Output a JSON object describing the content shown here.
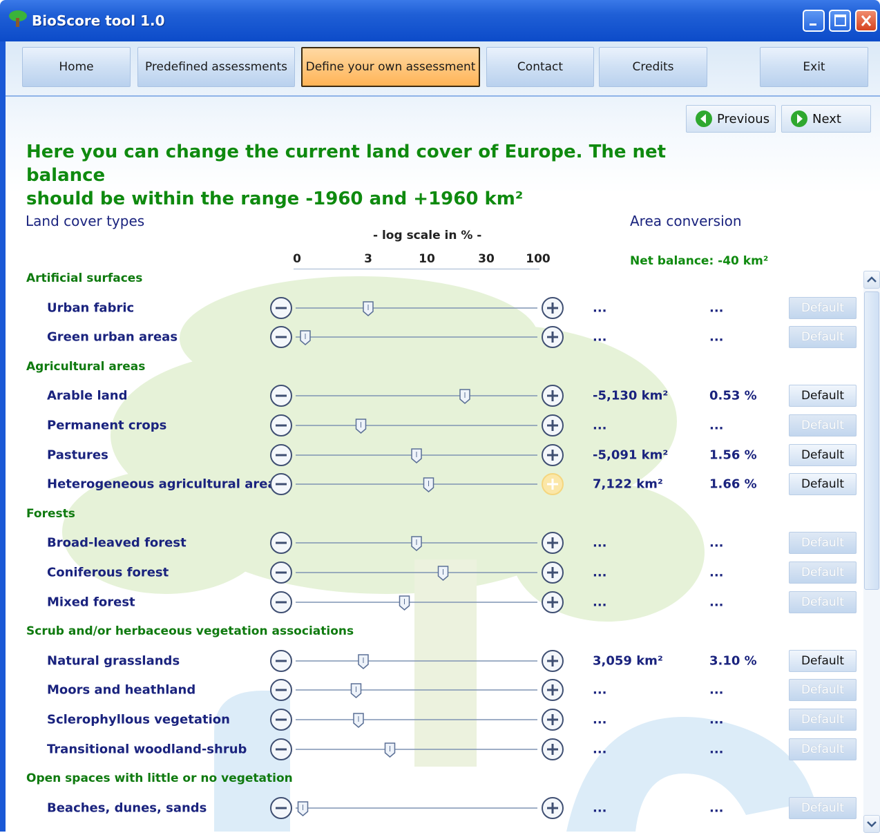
{
  "window": {
    "title": "BioScore tool  1.0"
  },
  "nav": [
    {
      "label": "Home",
      "active": false
    },
    {
      "label": "Predefined assessments",
      "active": false
    },
    {
      "label": "Define your own assessment",
      "active": true
    },
    {
      "label": "Contact",
      "active": false
    },
    {
      "label": "Credits",
      "active": false
    },
    {
      "label": "Exit",
      "active": false
    }
  ],
  "pager": {
    "previous": "Previous",
    "next": "Next"
  },
  "heading": {
    "line1": "Here you can change the current land cover of Europe. The net balance",
    "line2": "should be within the range -1960 and +1960  km²"
  },
  "columns": {
    "land_cover": "Land cover types",
    "scale_title": "- log scale in % -",
    "ticks": [
      "0",
      "3",
      "10",
      "30",
      "100"
    ],
    "area_conversion": "Area conversion",
    "net_balance": "Net balance: -40  km²"
  },
  "categories": [
    "Artificial surfaces",
    "Agricultural areas",
    "Forests",
    "Scrub and/or herbaceous vegetation associations",
    "Open spaces with little or no vegetation"
  ],
  "rows": [
    {
      "label": "Urban fabric",
      "area": "...",
      "percent": "...",
      "default": "Default",
      "default_enabled": false,
      "slider_level": 0.3
    },
    {
      "label": "Green urban areas",
      "area": "...",
      "percent": "...",
      "default": "Default",
      "default_enabled": false,
      "slider_level": 0.04
    },
    {
      "label": "Arable land",
      "area": "-5,130  km²",
      "percent": "0.53 %",
      "default": "Default",
      "default_enabled": true,
      "slider_level": 0.7
    },
    {
      "label": "Permanent crops",
      "area": "...",
      "percent": "...",
      "default": "Default",
      "default_enabled": false,
      "slider_level": 0.27
    },
    {
      "label": "Pastures",
      "area": "-5,091  km²",
      "percent": "1.56 %",
      "default": "Default",
      "default_enabled": true,
      "slider_level": 0.5
    },
    {
      "label": "Heterogeneous agricultural areas",
      "area": "7,122  km²",
      "percent": "1.66 %",
      "default": "Default",
      "default_enabled": true,
      "slider_level": 0.55
    },
    {
      "label": "Broad-leaved forest",
      "area": "...",
      "percent": "...",
      "default": "Default",
      "default_enabled": false,
      "slider_level": 0.5
    },
    {
      "label": "Coniferous forest",
      "area": "...",
      "percent": "...",
      "default": "Default",
      "default_enabled": false,
      "slider_level": 0.61
    },
    {
      "label": "Mixed forest",
      "area": "...",
      "percent": "...",
      "default": "Default",
      "default_enabled": false,
      "slider_level": 0.45
    },
    {
      "label": "Natural grasslands",
      "area": "3,059  km²",
      "percent": "3.10 %",
      "default": "Default",
      "default_enabled": true,
      "slider_level": 0.28
    },
    {
      "label": "Moors and heathland",
      "area": "...",
      "percent": "...",
      "default": "Default",
      "default_enabled": false,
      "slider_level": 0.25
    },
    {
      "label": "Sclerophyllous vegetation",
      "area": "...",
      "percent": "...",
      "default": "Default",
      "default_enabled": false,
      "slider_level": 0.26
    },
    {
      "label": "Transitional woodland-shrub",
      "area": "...",
      "percent": "...",
      "default": "Default",
      "default_enabled": false,
      "slider_level": 0.39
    },
    {
      "label": "Beaches, dunes, sands",
      "area": "...",
      "percent": "...",
      "default": "Default",
      "default_enabled": false,
      "slider_level": 0.03
    }
  ],
  "colors": {
    "heading_green": "#0f8a0f",
    "label_navy": "#1a237e",
    "active_tab": "#ffb457",
    "titlebar": "#0c4bc9"
  }
}
